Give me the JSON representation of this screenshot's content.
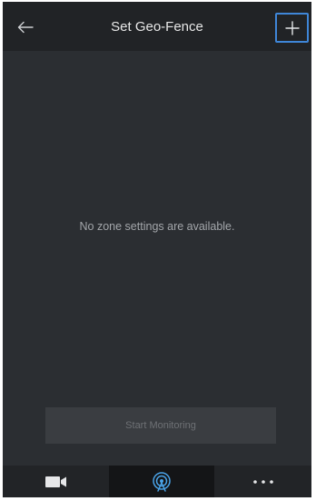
{
  "header": {
    "title": "Set Geo-Fence",
    "back_icon": "arrow-left-icon",
    "add_icon": "plus-icon"
  },
  "main": {
    "empty_message": "No zone settings are available."
  },
  "actions": {
    "start_monitoring_label": "Start Monitoring",
    "start_monitoring_enabled": false
  },
  "bottom_nav": {
    "items": [
      {
        "icon": "video-camera-icon",
        "active": false
      },
      {
        "icon": "geofence-radar-icon",
        "active": true
      },
      {
        "icon": "more-dots-icon",
        "active": false
      }
    ]
  },
  "colors": {
    "background": "#2b2e32",
    "header": "#212326",
    "accent_highlight": "#3f86d8",
    "active_nav_icon": "#4aa3e8"
  }
}
